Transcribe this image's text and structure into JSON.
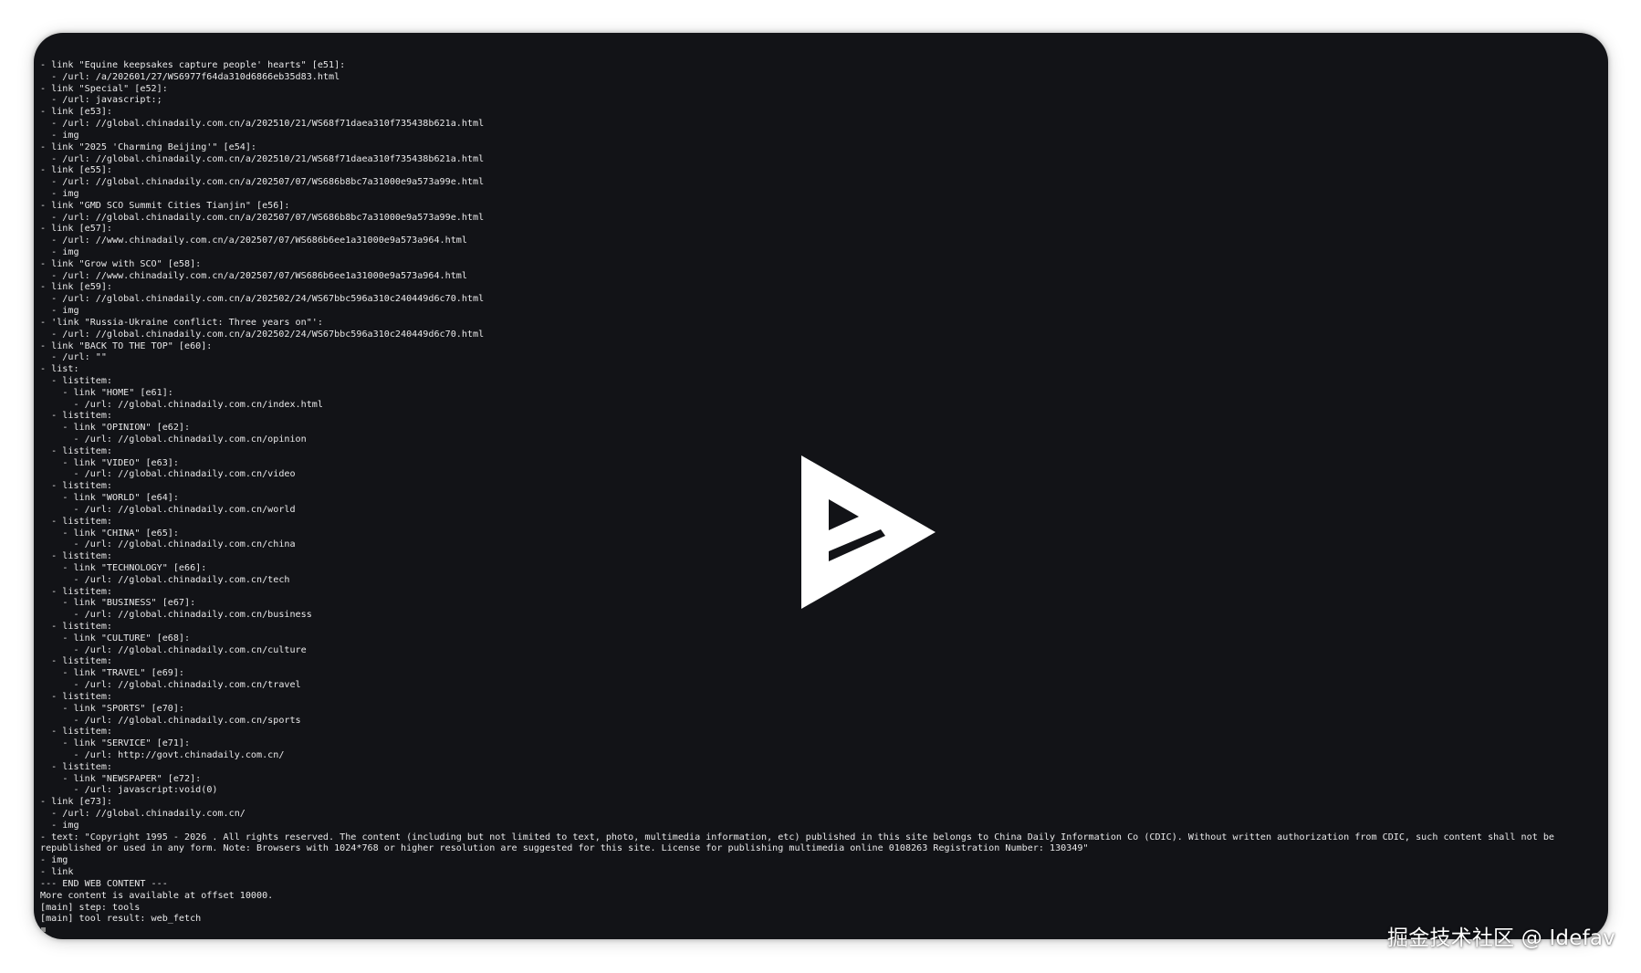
{
  "terminal": {
    "lines": [
      "- link \"Equine keepsakes capture people' hearts\" [e51]:",
      "  - /url: /a/202601/27/WS6977f64da310d6866eb35d83.html",
      "- link \"Special\" [e52]:",
      "  - /url: javascript:;",
      "- link [e53]:",
      "  - /url: //global.chinadaily.com.cn/a/202510/21/WS68f71daea310f735438b621a.html",
      "  - img",
      "- link \"2025 'Charming Beijing'\" [e54]:",
      "  - /url: //global.chinadaily.com.cn/a/202510/21/WS68f71daea310f735438b621a.html",
      "- link [e55]:",
      "  - /url: //global.chinadaily.com.cn/a/202507/07/WS686b8bc7a31000e9a573a99e.html",
      "  - img",
      "- link \"GMD SCO Summit Cities Tianjin\" [e56]:",
      "  - /url: //global.chinadaily.com.cn/a/202507/07/WS686b8bc7a31000e9a573a99e.html",
      "- link [e57]:",
      "  - /url: //www.chinadaily.com.cn/a/202507/07/WS686b6ee1a31000e9a573a964.html",
      "  - img",
      "- link \"Grow with SCO\" [e58]:",
      "  - /url: //www.chinadaily.com.cn/a/202507/07/WS686b6ee1a31000e9a573a964.html",
      "- link [e59]:",
      "  - /url: //global.chinadaily.com.cn/a/202502/24/WS67bbc596a310c240449d6c70.html",
      "  - img",
      "- 'link \"Russia-Ukraine conflict: Three years on\"':",
      "  - /url: //global.chinadaily.com.cn/a/202502/24/WS67bbc596a310c240449d6c70.html",
      "- link \"BACK TO THE TOP\" [e60]:",
      "  - /url: \"\"",
      "- list:",
      "  - listitem:",
      "    - link \"HOME\" [e61]:",
      "      - /url: //global.chinadaily.com.cn/index.html",
      "  - listitem:",
      "    - link \"OPINION\" [e62]:",
      "      - /url: //global.chinadaily.com.cn/opinion",
      "  - listitem:",
      "    - link \"VIDEO\" [e63]:",
      "      - /url: //global.chinadaily.com.cn/video",
      "  - listitem:",
      "    - link \"WORLD\" [e64]:",
      "      - /url: //global.chinadaily.com.cn/world",
      "  - listitem:",
      "    - link \"CHINA\" [e65]:",
      "      - /url: //global.chinadaily.com.cn/china",
      "  - listitem:",
      "    - link \"TECHNOLOGY\" [e66]:",
      "      - /url: //global.chinadaily.com.cn/tech",
      "  - listitem:",
      "    - link \"BUSINESS\" [e67]:",
      "      - /url: //global.chinadaily.com.cn/business",
      "  - listitem:",
      "    - link \"CULTURE\" [e68]:",
      "      - /url: //global.chinadaily.com.cn/culture",
      "  - listitem:",
      "    - link \"TRAVEL\" [e69]:",
      "      - /url: //global.chinadaily.com.cn/travel",
      "  - listitem:",
      "    - link \"SPORTS\" [e70]:",
      "      - /url: //global.chinadaily.com.cn/sports",
      "  - listitem:",
      "    - link \"SERVICE\" [e71]:",
      "      - /url: http://govt.chinadaily.com.cn/",
      "  - listitem:",
      "    - link \"NEWSPAPER\" [e72]:",
      "      - /url: javascript:void(0)",
      "- link [e73]:",
      "  - /url: //global.chinadaily.com.cn/",
      "  - img",
      "- text: \"Copyright 1995 - 2026 . All rights reserved. The content (including but not limited to text, photo, multimedia information, etc) published in this site belongs to China Daily Information Co (CDIC). Without written authorization from CDIC, such content shall not be republished or used in any form. Note: Browsers with 1024*768 or higher resolution are suggested for this site. License for publishing multimedia online 0108263 Registration Number: 130349\"",
      "- img",
      "- link",
      "--- END WEB CONTENT ---",
      "More content is available at offset 10000.",
      "[main] step: tools",
      "[main] tool result: web_fetch"
    ]
  },
  "overlay": {
    "icon": "play-logo-icon"
  },
  "watermark": {
    "text": "掘金技术社区 @ Idefav"
  },
  "colors": {
    "window_bg": "#121317",
    "text": "#e9e9ea",
    "page_bg": "#ffffff"
  }
}
